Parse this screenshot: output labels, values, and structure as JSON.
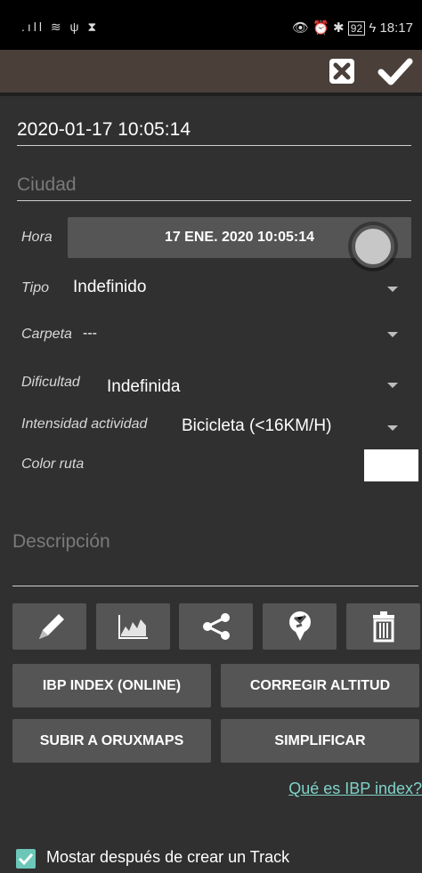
{
  "status_bar": {
    "left_icons": "signal wifi usb hourglass",
    "right_icons": "eye alarm bluetooth",
    "battery": "92",
    "time": "18:17"
  },
  "action_bar": {
    "cancel_icon": "close-box-icon",
    "confirm_icon": "check-icon"
  },
  "form": {
    "date_value": "2020-01-17 10:05:14",
    "city_placeholder": "Ciudad",
    "hora": {
      "label": "Hora",
      "value": "17 ENE. 2020 10:05:14"
    },
    "tipo": {
      "label": "Tipo",
      "value": "Indefinido"
    },
    "carpeta": {
      "label": "Carpeta",
      "value": "---"
    },
    "dificultad": {
      "label": "Dificultad",
      "value": "Indefinida"
    },
    "intensidad": {
      "label": "Intensidad actividad",
      "value": "Bicicleta (<16KM/H)"
    },
    "color_ruta": {
      "label": "Color ruta",
      "color": "#ffffff"
    },
    "descripcion_placeholder": "Descripción"
  },
  "tools": [
    "edit-icon",
    "chart-icon",
    "share-icon",
    "map-pin-icon",
    "trash-icon"
  ],
  "buttons": {
    "ibp_index": "IBP INDEX (ONLINE)",
    "corregir_altitud": "CORREGIR ALTITUD",
    "subir_oruxmaps": "SUBIR A ORUXMAPS",
    "simplificar": "SIMPLIFICAR"
  },
  "link_ibp": "Qué es IBP index?",
  "show_after_create": {
    "label": "Mostar después de crear un Track",
    "checked": true
  },
  "colors": {
    "accent": "#6cc7b8",
    "background": "#303030",
    "action_bar": "#4a3f39",
    "button": "#555555"
  }
}
